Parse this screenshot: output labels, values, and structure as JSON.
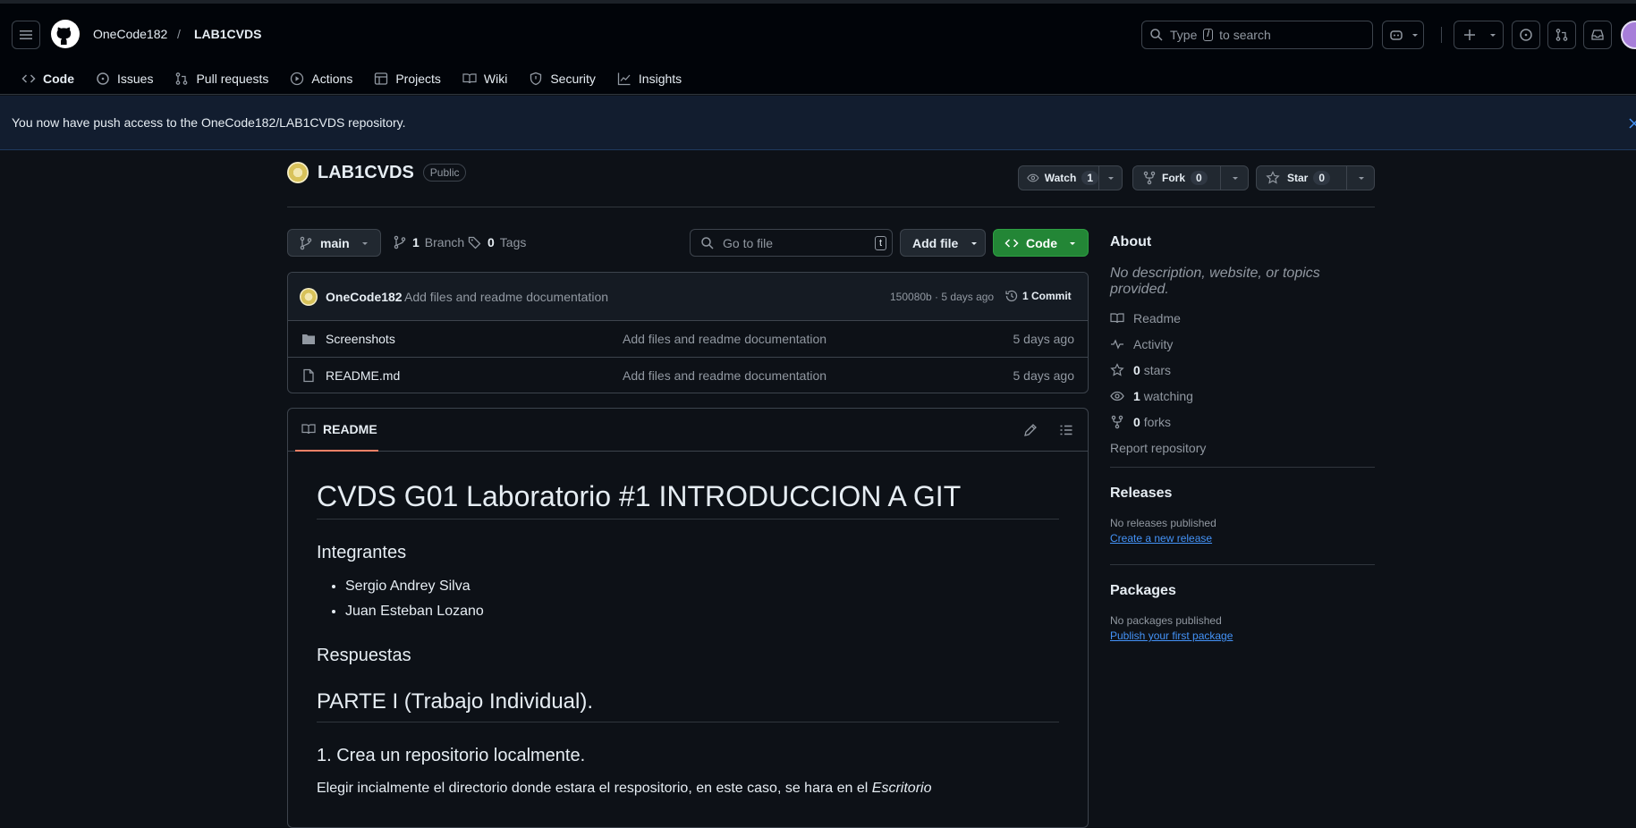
{
  "header": {
    "owner": "OneCode182",
    "separator": "/",
    "repo": "LAB1CVDS",
    "search_placeholder_pre": "Type",
    "search_key": "/",
    "search_placeholder_post": "to search"
  },
  "tabs": [
    {
      "label": "Code",
      "icon": "code-icon"
    },
    {
      "label": "Issues",
      "icon": "issue-icon"
    },
    {
      "label": "Pull requests",
      "icon": "pull-request-icon"
    },
    {
      "label": "Actions",
      "icon": "play-icon"
    },
    {
      "label": "Projects",
      "icon": "table-icon"
    },
    {
      "label": "Wiki",
      "icon": "book-icon"
    },
    {
      "label": "Security",
      "icon": "shield-icon"
    },
    {
      "label": "Insights",
      "icon": "graph-icon"
    }
  ],
  "banner": {
    "text": "You now have push access to the OneCode182/LAB1CVDS repository."
  },
  "repo": {
    "name": "LAB1CVDS",
    "visibility": "Public",
    "watch_label": "Watch",
    "watch_count": "1",
    "fork_label": "Fork",
    "fork_count": "0",
    "star_label": "Star",
    "star_count": "0"
  },
  "toolbar": {
    "branch": "main",
    "branches_count": "1",
    "branches_label": "Branch",
    "tags_count": "0",
    "tags_label": "Tags",
    "goto_placeholder": "Go to file",
    "goto_key": "t",
    "add_file": "Add file",
    "code": "Code"
  },
  "commit": {
    "author": "OneCode182",
    "message": "Add files and readme documentation",
    "meta": "150080b · 5 days ago",
    "commits": "1 Commit"
  },
  "files": [
    {
      "name": "Screenshots",
      "type": "folder",
      "message": "Add files and readme documentation",
      "age": "5 days ago"
    },
    {
      "name": "README.md",
      "type": "file",
      "message": "Add files and readme documentation",
      "age": "5 days ago"
    }
  ],
  "readme": {
    "tab": "README",
    "h1": "CVDS G01 Laboratorio #1 INTRODUCCION A GIT",
    "h_integrantes": "Integrantes",
    "members": [
      "Sergio Andrey Silva",
      "Juan Esteban Lozano"
    ],
    "h_respuestas": "Respuestas",
    "h_parte": "PARTE I (Trabajo Individual).",
    "h_step1": "1. Crea un repositorio localmente.",
    "p1": "Elegir incialmente el directorio donde estara el respositorio, en este caso, se hara en el ",
    "p1_em": "Escritorio"
  },
  "about": {
    "title": "About",
    "description": "No description, website, or topics provided.",
    "readme": "Readme",
    "activity": "Activity",
    "stars_count": "0",
    "stars_label": "stars",
    "watching_count": "1",
    "watching_label": "watching",
    "forks_count": "0",
    "forks_label": "forks",
    "report": "Report repository"
  },
  "releases": {
    "title": "Releases",
    "empty": "No releases published",
    "link": "Create a new release"
  },
  "packages": {
    "title": "Packages",
    "empty": "No packages published",
    "link": "Publish your first package"
  },
  "colors": {
    "accent_underline": "#f78166",
    "code_button": "#238636",
    "link": "#4493f8"
  }
}
